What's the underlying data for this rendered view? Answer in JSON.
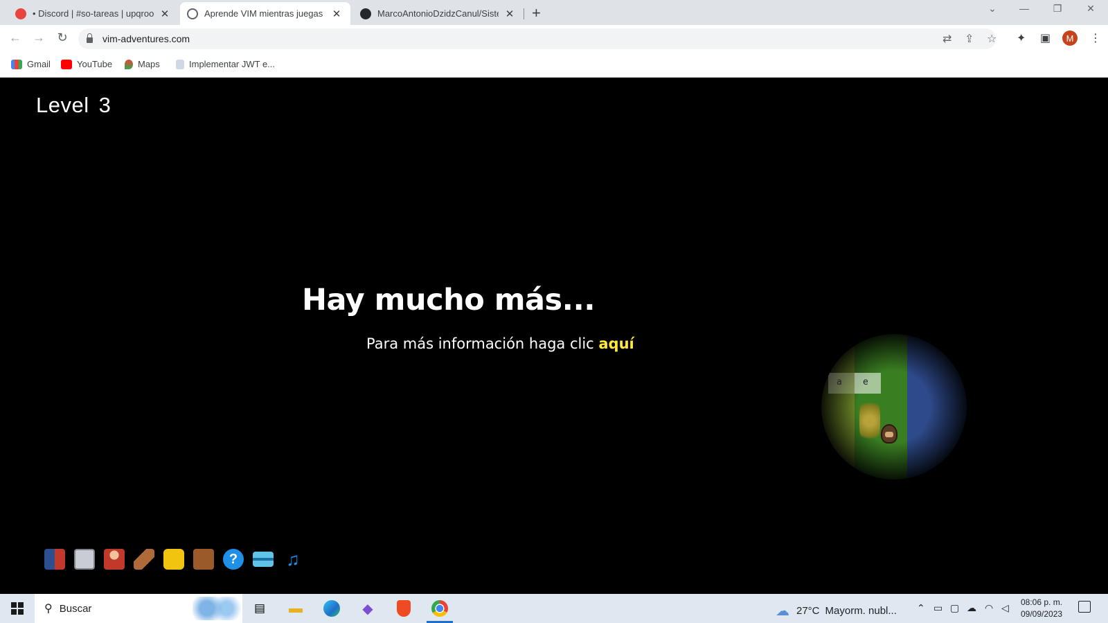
{
  "browser": {
    "tabs": [
      {
        "title": "• Discord | #so-tareas | upqroo",
        "active": false,
        "favicon": "discord-favicon"
      },
      {
        "title": "Aprende VIM mientras juegas - V",
        "active": true,
        "favicon": "globe-favicon"
      },
      {
        "title": "MarcoAntonioDzidzCanul/Sistem",
        "active": false,
        "favicon": "github-favicon"
      }
    ],
    "new_tab_glyph": "+",
    "url": "vim-adventures.com",
    "profile_initial": "M",
    "bookmarks": [
      {
        "label": "Gmail",
        "icon": "gmail-icon"
      },
      {
        "label": "YouTube",
        "icon": "youtube-icon"
      },
      {
        "label": "Maps",
        "icon": "maps-icon"
      },
      {
        "label": "Implementar JWT e...",
        "icon": "bookmark-icon"
      }
    ]
  },
  "game": {
    "level_label": "Level",
    "level_number": "3",
    "headline": "Hay mucho más...",
    "info_text": "Para más información haga clic ",
    "info_link": "aquí",
    "map_letters": [
      "a",
      "e"
    ],
    "tool_icons": [
      "book-icon",
      "keyboard-icon",
      "character-icon",
      "ruler-icon",
      "puzzle-icon",
      "spellbook-icon",
      "help-icon",
      "card-icon",
      "music-icon"
    ]
  },
  "taskbar": {
    "search_placeholder": "Buscar",
    "weather_temp": "27°C",
    "weather_desc": "Mayorm. nubl...",
    "time": "08:06 p. m.",
    "date": "09/09/2023"
  },
  "colors": {
    "link_yellow": "#ffe83a",
    "profile_bg": "#c4451c",
    "taskbar_bg": "#dfe8f1"
  }
}
